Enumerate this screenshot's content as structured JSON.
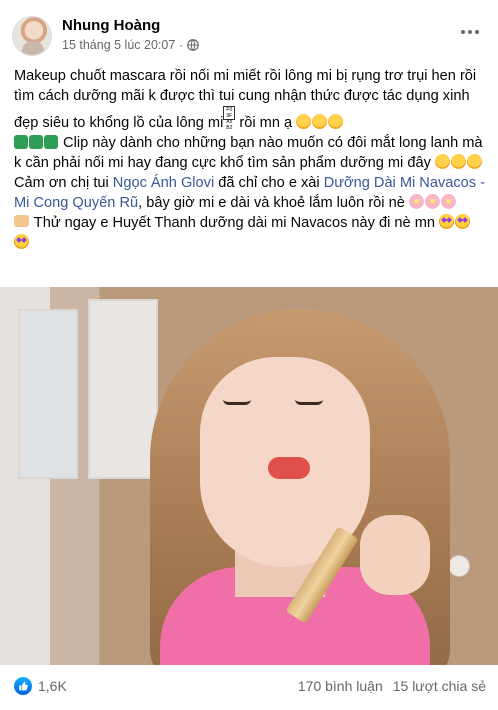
{
  "post": {
    "author": "Nhung Hoàng",
    "timestamp": "15 tháng 5 lúc 20:07",
    "separator": "·",
    "privacy_icon": "globe-icon",
    "more_icon": "more-options-icon",
    "caption": {
      "line1_prefix": "Makeup chuốt mascara rồi nối mi miết rồi lông mi bị rụng trơ trụi hen rồi tìm cách dưỡng mãi k được thì tui cung nhận thức được tác dụng xinh đẹp siêu to khổng lồ của lông mi",
      "line1_suffix": " rồi mn ạ",
      "line2": " Clip này dành cho những bạn nào muốn có đôi mắt long lanh mà k cần phải nối mi hay đang cực khổ tìm sản phẩm dưỡng mi đây",
      "line3_prefix": "Cảm ơn chị tui ",
      "link1": "Ngọc Ánh Glovi",
      "line3_mid": " đã chỉ cho e xài ",
      "link2": "Dưỡng Dài Mi Navacos - Mi Cong Quyến Rũ",
      "line3_suffix": ", bây giờ mi e dài và khoẻ lắm luôn rồi nè",
      "line4": " Thử ngay e Huyết Thanh dưỡng dài mi Navacos này đi nè mn"
    },
    "media": {
      "kind": "video-thumbnail"
    },
    "footer": {
      "reactions_count": "1,6K",
      "comments": "170 bình luận",
      "shares": "15 lượt chia sẻ"
    },
    "colors": {
      "link": "#385898",
      "secondary_text": "#65676b",
      "like_blue": "#1877f2"
    }
  }
}
